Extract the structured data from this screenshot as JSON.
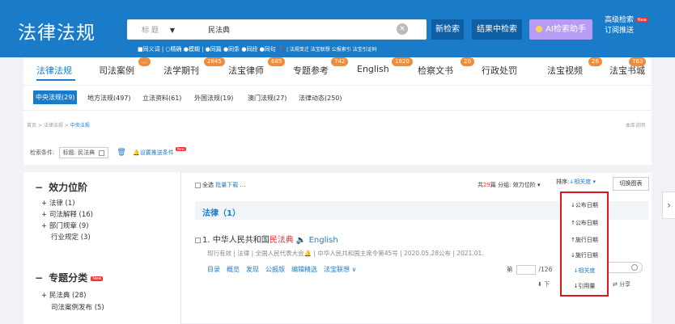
{
  "header": {
    "logo": "法律法规",
    "search_field": "标 题",
    "search_field_arrow": "▼",
    "search_value": "民法典",
    "clear_glyph": "✕",
    "new_search": "新检索",
    "result_search": "结果中检索",
    "ai_button": "AI检索助手",
    "advanced_line1": "高级检索",
    "advanced_new": "New",
    "advanced_line2": "订阅推送",
    "options": "■同义词 | ○精确 ●模糊 | ●同篇 ●同条 ●同段 ●同句 ❓",
    "options_small": "| 法规变迁  法宝联想  公报索引  法宝引证码"
  },
  "nav": {
    "items": [
      "法律法规",
      "司法案例",
      "法学期刊",
      "法宝律师",
      "专题参考",
      "English",
      "检察文书",
      "行政处罚",
      "法宝视频",
      "法宝书城"
    ],
    "badges": [
      "...",
      "2845",
      "685",
      "742",
      "1920",
      "20",
      "26",
      "763"
    ]
  },
  "subnav": {
    "active": "中央法规(29)",
    "items": [
      "地方法规(497)",
      "立法资料(61)",
      "外国法规(19)",
      "澳门法规(27)",
      "法律动态(250)"
    ]
  },
  "breadcrumb": {
    "prefix": "首页 > 法律法规 > ",
    "current": "中央法规",
    "library": "本库说明"
  },
  "condition": {
    "label": "检索条件:",
    "chip": "标题: 民法典",
    "trash": "🗑",
    "bell": "🔔",
    "alert": "设置推送条件",
    "new": "New"
  },
  "sidebar": {
    "dash": "−",
    "section1": "效力位阶",
    "items1": [
      "+ 法律 (1)",
      "+ 司法解释 (16)",
      "+ 部门规章 (9)",
      "行业规定 (3)"
    ],
    "section2": "专题分类",
    "section2_new": "New",
    "items2": [
      "+ 民法典 (28)",
      "司法案例发布 (5)"
    ]
  },
  "toolbar": {
    "select_all": "全选",
    "batch_download": "批量下载",
    "more": "…",
    "count_prefix": "共",
    "count": "29",
    "count_suffix": "篇  分组: 效力位阶 ▾",
    "sort_label": "排序:",
    "sort_value": "↓相关度 ▾",
    "chart_button": "切换图表"
  },
  "results": {
    "group_title": "法律（1）",
    "item_prefix": "1. 中华人民共和国",
    "item_highlight": "民法典",
    "item_speaker": "🔈",
    "item_english": "English",
    "meta": "现行有效 | 法律 | 全国人民代表大会🔔 | 中华人民共和国主席令第45号 | 2020.05.28公布 | 2021.01.",
    "actions": [
      "目录",
      "概览",
      "发现",
      "公报版",
      "编辑精选",
      "法宝联想 ∨"
    ],
    "page_label": "第",
    "page_total": "/126",
    "mini_text": "索",
    "download": "⬇ 下",
    "share": "⇄ 分享"
  },
  "sort_dropdown": {
    "options": [
      "↓公布日期",
      "↑公布日期",
      "↑施行日期",
      "↓施行日期",
      "↓相关度",
      "↓引用量"
    ],
    "selected_index": 4
  },
  "scroll_arrow": "›"
}
